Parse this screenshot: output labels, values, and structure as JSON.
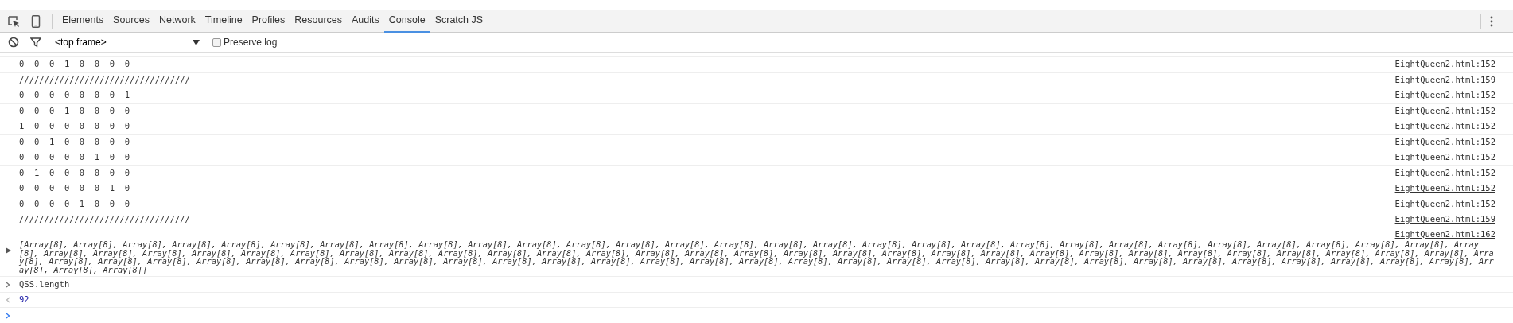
{
  "toolbar": {
    "tabs": [
      {
        "label": "Elements",
        "selected": false
      },
      {
        "label": "Sources",
        "selected": false
      },
      {
        "label": "Network",
        "selected": false
      },
      {
        "label": "Timeline",
        "selected": false
      },
      {
        "label": "Profiles",
        "selected": false
      },
      {
        "label": "Resources",
        "selected": false
      },
      {
        "label": "Audits",
        "selected": false
      },
      {
        "label": "Console",
        "selected": true
      },
      {
        "label": "Scratch JS",
        "selected": false
      }
    ]
  },
  "filter_bar": {
    "frame": "<top frame>",
    "preserve_log": {
      "label": "Preserve log",
      "checked": false
    }
  },
  "messages": [
    {
      "kind": "log",
      "text": "0  0  0  1  0  0  0  0",
      "source": "EightQueen2.html:152"
    },
    {
      "kind": "log",
      "text": "//////////////////////////////////",
      "source": "EightQueen2.html:159"
    },
    {
      "kind": "log",
      "text": "0  0  0  0  0  0  0  1",
      "source": "EightQueen2.html:152"
    },
    {
      "kind": "log",
      "text": "0  0  0  1  0  0  0  0",
      "source": "EightQueen2.html:152"
    },
    {
      "kind": "log",
      "text": "1  0  0  0  0  0  0  0",
      "source": "EightQueen2.html:152"
    },
    {
      "kind": "log",
      "text": "0  0  1  0  0  0  0  0",
      "source": "EightQueen2.html:152"
    },
    {
      "kind": "log",
      "text": "0  0  0  0  0  1  0  0",
      "source": "EightQueen2.html:152"
    },
    {
      "kind": "log",
      "text": "0  1  0  0  0  0  0  0",
      "source": "EightQueen2.html:152"
    },
    {
      "kind": "log",
      "text": "0  0  0  0  0  0  1  0",
      "source": "EightQueen2.html:152"
    },
    {
      "kind": "log",
      "text": "0  0  0  0  1  0  0  0",
      "source": "EightQueen2.html:152"
    },
    {
      "kind": "log",
      "text": "//////////////////////////////////",
      "source": "EightQueen2.html:159"
    },
    {
      "kind": "object",
      "expanded": false,
      "text": "[Array[8], Array[8], Array[8], Array[8], Array[8], Array[8], Array[8], Array[8], Array[8], Array[8], Array[8], Array[8], Array[8], Array[8], Array[8], Array[8], Array[8], Array[8], Array[8], Array[8], Array[8], Array[8], Array[8], Array[8], Array[8], Array[8], Array[8], Array[8], Array[8], Array[8], Array[8], Array[8], Array[8], Array[8], Array[8], Array[8], Array[8], Array[8], Array[8], Array[8], Array[8], Array[8], Array[8], Array[8], Array[8], Array[8], Array[8], Array[8], Array[8], Array[8], Array[8], Array[8], Array[8], Array[8], Array[8], Array[8], Array[8], Array[8], Array[8], Array[8], Array[8], Array[8], Array[8], Array[8], Array[8], Array[8], Array[8], Array[8], Array[8], Array[8], Array[8], Array[8], Array[8], Array[8], Array[8], Array[8], Array[8], Array[8], Array[8], Array[8], Array[8], Array[8], Array[8], Array[8], Array[8], Array[8], Array[8], Array[8], Array[8], Array[8], Array[8], Array[8]]",
      "source": "EightQueen2.html:162"
    },
    {
      "kind": "input",
      "text": "QSS.length"
    },
    {
      "kind": "result",
      "text": "92"
    },
    {
      "kind": "prompt"
    }
  ]
}
